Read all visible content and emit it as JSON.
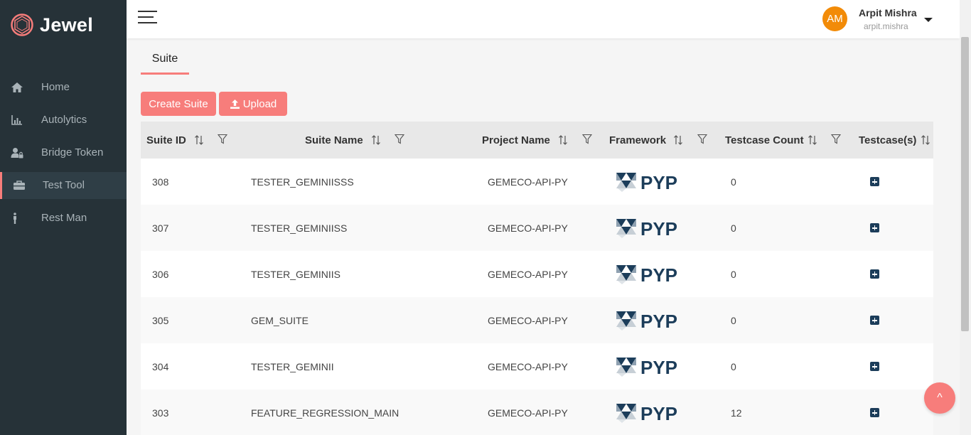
{
  "brand": {
    "name": "Jewel",
    "icon": "jewel-logo-icon"
  },
  "sidebar": {
    "items": [
      {
        "label": "Home",
        "icon": "home-icon",
        "active": false
      },
      {
        "label": "Autolytics",
        "icon": "bar-chart-icon",
        "active": false
      },
      {
        "label": "Bridge Token",
        "icon": "user-lock-icon",
        "active": false
      },
      {
        "label": "Test Tool",
        "icon": "toolbox-icon",
        "active": true
      },
      {
        "label": "Rest Man",
        "icon": "person-icon",
        "active": false
      }
    ]
  },
  "header": {
    "menu_icon": "hamburger-icon",
    "avatar_initials": "AM",
    "user_name": "Arpit Mishra",
    "user_handle": "arpit.mishra"
  },
  "tabs": [
    {
      "label": "Suite",
      "active": true
    }
  ],
  "toolbar": {
    "create_label": "Create Suite",
    "upload_label": "Upload"
  },
  "table": {
    "columns": [
      "Suite ID",
      "Suite Name",
      "Project Name",
      "Framework",
      "Testcase Count",
      "Testcase(s)"
    ],
    "rows": [
      {
        "id": "308",
        "name": "TESTER_GEMINIISSS",
        "project": "GEMECO-API-PY",
        "framework": "PYP",
        "count": "0"
      },
      {
        "id": "307",
        "name": "TESTER_GEMINIISS",
        "project": "GEMECO-API-PY",
        "framework": "PYP",
        "count": "0"
      },
      {
        "id": "306",
        "name": "TESTER_GEMINIIS",
        "project": "GEMECO-API-PY",
        "framework": "PYP",
        "count": "0"
      },
      {
        "id": "305",
        "name": "GEM_SUITE",
        "project": "GEMECO-API-PY",
        "framework": "PYP",
        "count": "0"
      },
      {
        "id": "304",
        "name": "TESTER_GEMINII",
        "project": "GEMECO-API-PY",
        "framework": "PYP",
        "count": "0"
      },
      {
        "id": "303",
        "name": "FEATURE_REGRESSION_MAIN",
        "project": "GEMECO-API-PY",
        "framework": "PYP",
        "count": "12"
      }
    ]
  },
  "scroll_top_label": "^",
  "colors": {
    "sidebar_bg": "#263238",
    "accent": "#f77d7b",
    "avatar": "#f28b08",
    "framework_dark": "#1c3d5a"
  }
}
